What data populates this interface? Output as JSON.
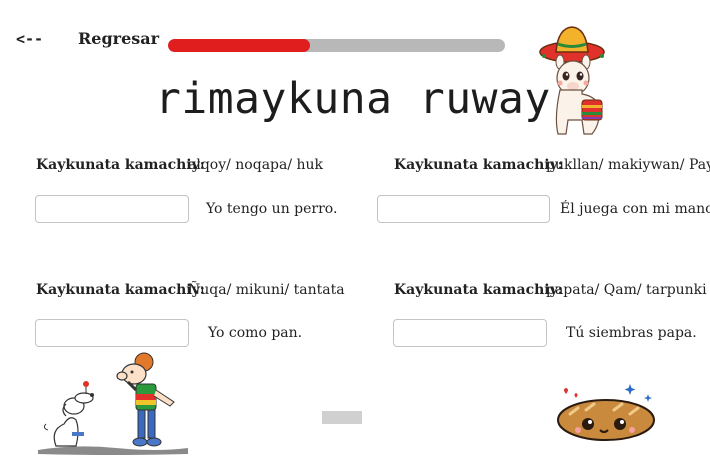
{
  "nav": {
    "back_arrow": "<--",
    "back_label": "Regresar"
  },
  "progress": {
    "fraction": 0.42,
    "fill_color": "#e01e1e",
    "track_color": "#b8b8b8"
  },
  "title": "rimaykuna ruway",
  "exercises": [
    {
      "label": "Kaykunata kamachiy:",
      "words": "alqoy/ noqapa/ huk",
      "answer_value": "",
      "sentence": "Yo tengo un perro."
    },
    {
      "label": "Kaykunata kamachiy:",
      "words": "pukllan/ makiywan/ Pay",
      "answer_value": "",
      "sentence": "Él juega con mi  mano."
    },
    {
      "label": "Kaykunata kamachiy:",
      "words": "Ñuqa/ mikuni/ tantata",
      "answer_value": "",
      "sentence": "Yo como pan."
    },
    {
      "label": "Kaykunata kamachiy:",
      "words": "papata/ Qam/ tarpunki",
      "answer_value": "",
      "sentence": "Tú siembras papa."
    }
  ],
  "illustrations": [
    "llama-with-sombrero",
    "boy-and-dog",
    "cute-bread-loaf"
  ]
}
